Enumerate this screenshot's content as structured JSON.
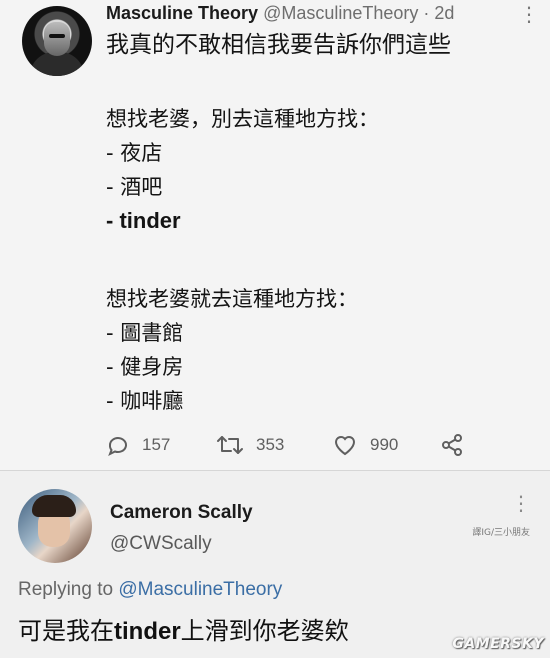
{
  "tweet": {
    "author_name": "Masculine Theory",
    "author_handle": "@MasculineTheory",
    "time_sep": " · ",
    "time": "2d",
    "more": "⋮",
    "line1": "我真的不敢相信我要告訴你們這些",
    "block2": {
      "heading": "想找老婆，別去這種地方找：",
      "items": [
        "- 夜店",
        "- 酒吧",
        "- tinder"
      ]
    },
    "block3": {
      "heading": "想找老婆就去這種地方找：",
      "items": [
        "- 圖書館",
        "- 健身房",
        "- 咖啡廳"
      ]
    },
    "actions": {
      "replies": "157",
      "retweets": "353",
      "likes": "990"
    }
  },
  "reply": {
    "author_name": "Cameron Scally",
    "author_handle": "@CWScally",
    "more": "⋮",
    "credit": "譯IG/三小朋友",
    "replying_prefix": "Replying to ",
    "replying_to": "@MasculineTheory",
    "text_part1": "可是我在",
    "text_part2": "tinder",
    "text_part3": "上滑到你老婆欸"
  },
  "watermark": "GAMERSKY",
  "colors": {
    "background": "#f2f2f2",
    "mention": "#3b6ea5",
    "muted": "#6e6e6e"
  },
  "icons": {
    "avatar1": "avatar-icon",
    "reply": "comment-icon",
    "retweet": "retweet-icon",
    "like": "heart-icon",
    "share": "share-icon"
  }
}
